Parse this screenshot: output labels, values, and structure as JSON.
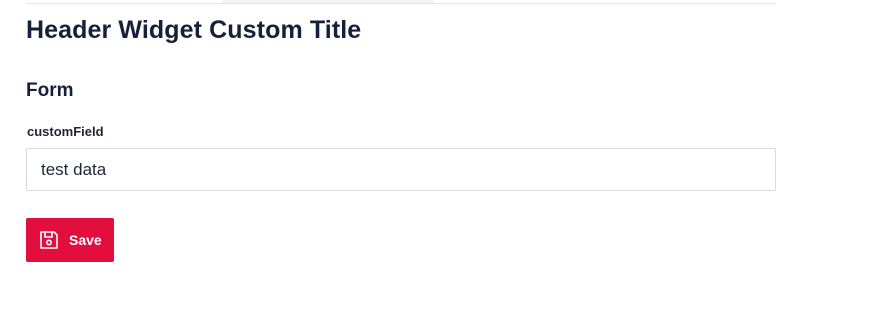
{
  "header": {
    "title": "Header Widget Custom Title"
  },
  "form": {
    "section_title": "Form",
    "field_label": "customField",
    "field_value": "test data",
    "save_label": "Save",
    "save_icon": "floppy-disk-icon",
    "accent_color": "#e30e3d"
  }
}
